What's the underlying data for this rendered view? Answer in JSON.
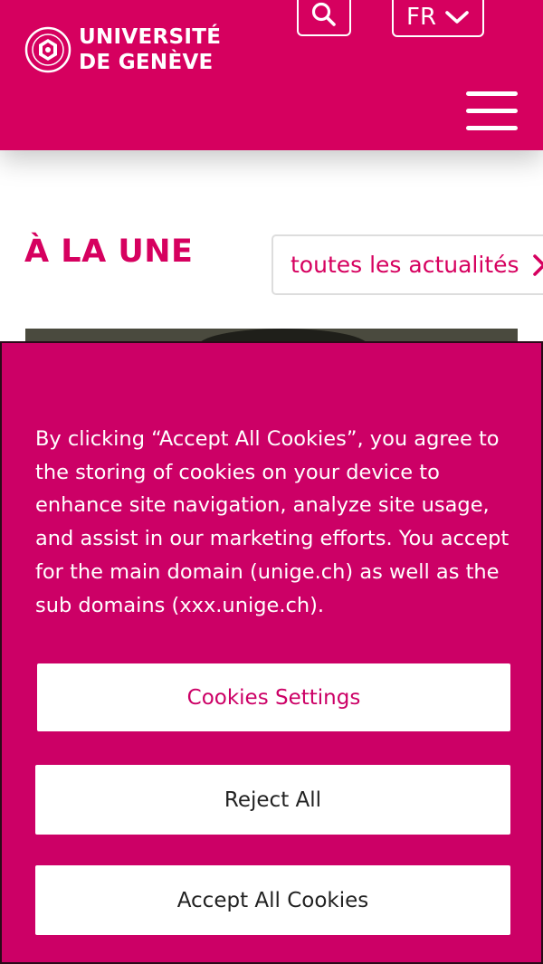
{
  "header": {
    "logo_line1": "UNIVERSITÉ",
    "logo_line2": "DE GENÈVE",
    "language": "FR",
    "icons": {
      "search": "search-icon",
      "language_dropdown": "chevron-down-icon",
      "menu": "hamburger-menu-icon",
      "logo": "university-seal-icon"
    }
  },
  "main": {
    "section_title": "À LA UNE",
    "all_news_link": "toutes les actualités"
  },
  "cookie_banner": {
    "message": "By clicking “Accept All Cookies”, you agree to the storing of cookies on your device to enhance site navigation, analyze site usage, and assist in our marketing efforts. You accept for the main domain (unige.ch) as well as the sub domains (xxx.unige.ch).",
    "settings_label": "Cookies Settings",
    "reject_label": "Reject All",
    "accept_label": "Accept All Cookies"
  },
  "colors": {
    "brand": "#d6005f",
    "banner": "#cc0066",
    "text_on_brand": "#ffffff"
  }
}
